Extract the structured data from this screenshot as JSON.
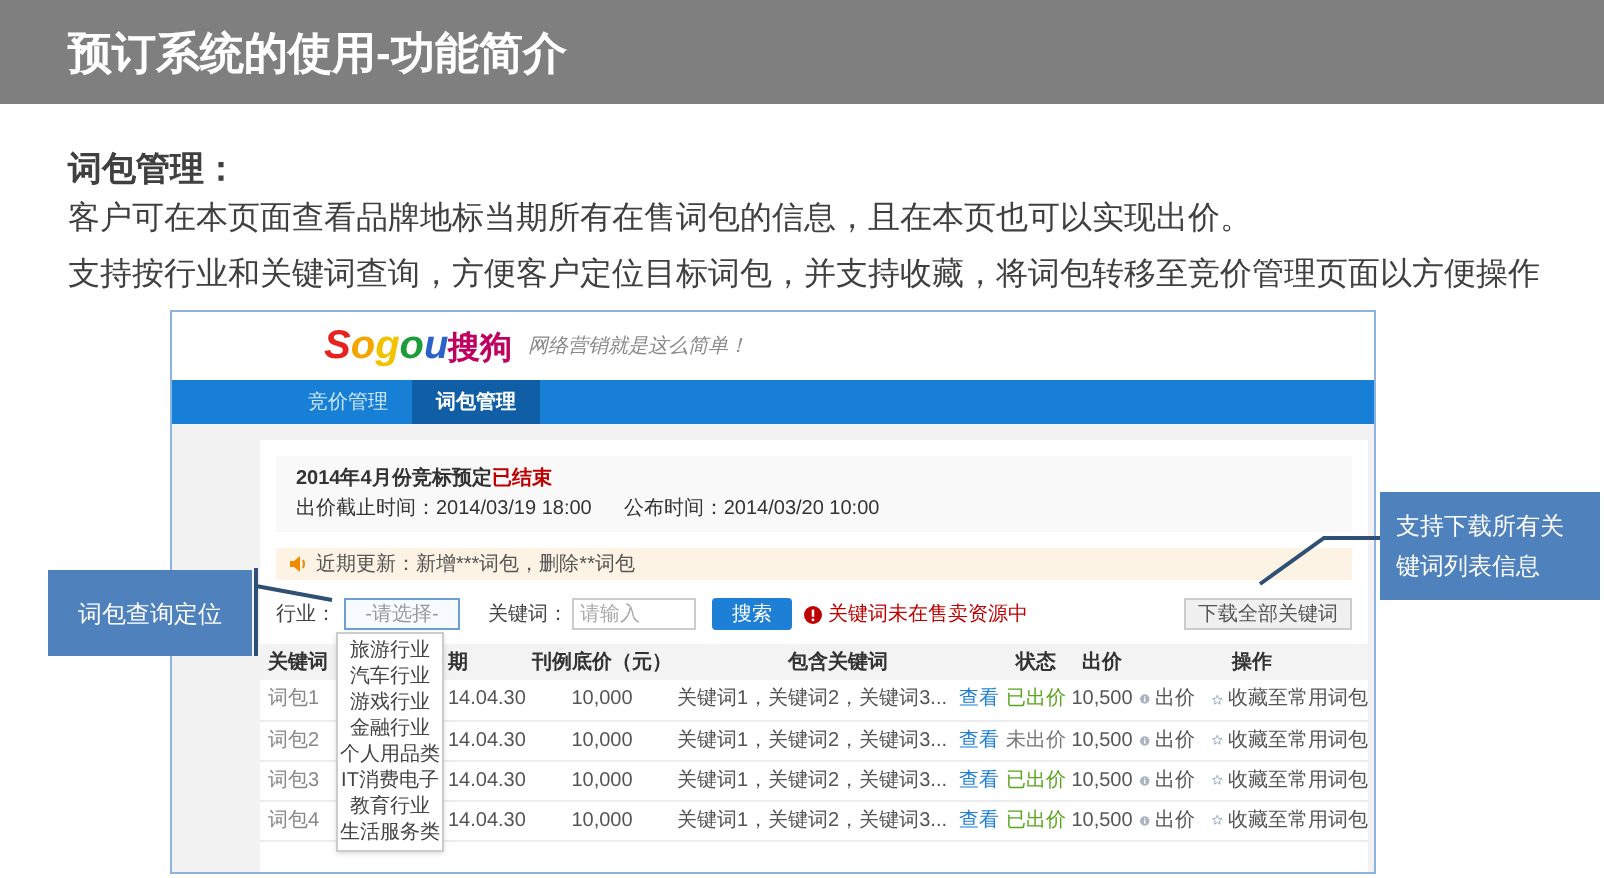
{
  "slide_title": "预订系统的使用-功能简介",
  "section": {
    "heading": "词包管理：",
    "lines": [
      "客户可在本页面查看品牌地标当期所有在售词包的信息，且在本页也可以实现出价。",
      "支持按行业和关键词查询，方便客户定位目标词包，并支持收藏，将词包转移至竞价管理页面以方便操作"
    ]
  },
  "screenshot": {
    "logo": {
      "latin": "Sogou",
      "chinese": "搜狗",
      "slogan": "网络营销就是这么简单！"
    },
    "tabs": [
      {
        "label": "竞价管理",
        "selected": false
      },
      {
        "label": "词包管理",
        "selected": true
      }
    ],
    "info": {
      "title": "2014年4月份竞标预定",
      "state": "已结束",
      "deadline": "出价截止时间：2014/03/19 18:00",
      "publish": "公布时间：2014/03/20 10:00"
    },
    "notice": "近期更新：新增***词包，删除**词包",
    "filters": {
      "industry_label": "行业：",
      "industry_placeholder": "-请选择-",
      "expanded": true,
      "industry_options": [
        "旅游行业",
        "汽车行业",
        "游戏行业",
        "金融行业",
        "个人用品类",
        "IT消费电子",
        "教育行业",
        "生活服务类"
      ],
      "keyword_label": "关键词：",
      "keyword_placeholder": "请输入",
      "search_button": "搜索",
      "error": "关键词未在售卖资源中",
      "download_button": "下载全部关键词"
    },
    "table": {
      "columns": [
        "关键词",
        "期",
        "刊例底价（元）",
        "包含关键词",
        "状态",
        "出价",
        "操作"
      ],
      "rows": [
        {
          "name": "词包1",
          "date": "14.04.30",
          "price": "10,000",
          "keywords": "关键词1，关键词2，关键词3...",
          "link": "查看",
          "status": "已出价",
          "bid_placed": true,
          "bid": "10,500",
          "action": "出价",
          "favorite": "收藏至常用词包"
        },
        {
          "name": "词包2",
          "date": "14.04.30",
          "price": "10,000",
          "keywords": "关键词1，关键词2，关键词3...",
          "link": "查看",
          "status": "未出价",
          "bid_placed": false,
          "bid": "10,500",
          "action": "出价",
          "favorite": "收藏至常用词包"
        },
        {
          "name": "词包3",
          "date": "14.04.30",
          "price": "10,000",
          "keywords": "关键词1，关键词2，关键词3...",
          "link": "查看",
          "status": "已出价",
          "bid_placed": true,
          "bid": "10,500",
          "action": "出价",
          "favorite": "收藏至常用词包"
        },
        {
          "name": "词包4",
          "date": "14.04.30",
          "price": "10,000",
          "keywords": "关键词1，关键词2，关键词3...",
          "link": "查看",
          "status": "已出价",
          "bid_placed": true,
          "bid": "10,500",
          "action": "出价",
          "favorite": "收藏至常用词包"
        }
      ]
    }
  },
  "callouts": [
    {
      "text": "词包查询定位"
    },
    {
      "text": "支持下载所有关键词列表信息"
    }
  ]
}
